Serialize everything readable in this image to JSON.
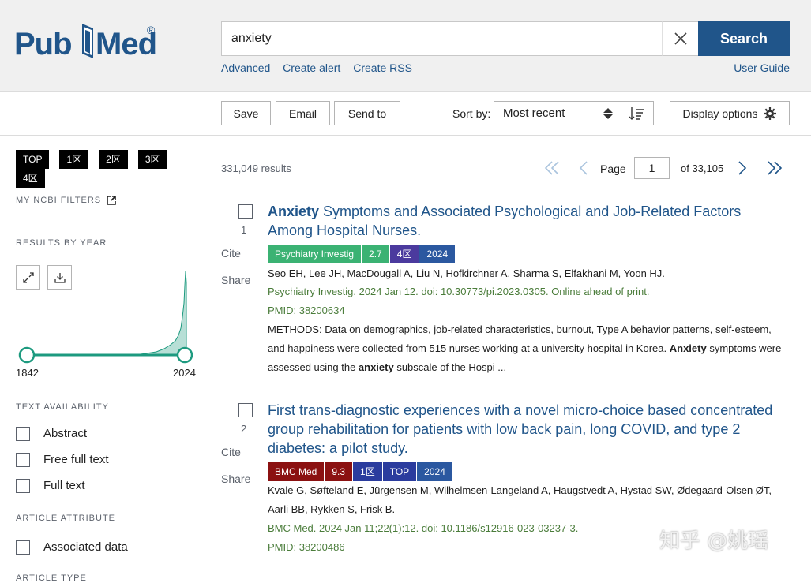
{
  "header": {
    "logo_pub": "Pub",
    "logo_med": "Med",
    "logo_reg": "®",
    "search_value": "anxiety",
    "search_button": "Search",
    "links": [
      "Advanced",
      "Create alert",
      "Create RSS"
    ],
    "user_guide": "User Guide"
  },
  "toolbar": {
    "save": "Save",
    "email": "Email",
    "send_to": "Send to",
    "sort_label": "Sort by:",
    "sort_value": "Most recent",
    "display_options": "Display options"
  },
  "sidebar": {
    "tags": [
      "TOP",
      "1区",
      "2区",
      "3区",
      "4区"
    ],
    "my_ncbi_filters": "MY NCBI FILTERS",
    "results_by_year": "RESULTS BY YEAR",
    "year_start": "1842",
    "year_end": "2024",
    "text_availability": "TEXT AVAILABILITY",
    "text_filters": [
      "Abstract",
      "Free full text",
      "Full text"
    ],
    "article_attribute": "ARTICLE ATTRIBUTE",
    "attribute_filters": [
      "Associated data"
    ],
    "article_type": "ARTICLE TYPE"
  },
  "results": {
    "count": "331,049 results",
    "page_label": "Page",
    "page_value": "1",
    "of_pages": "of 33,105",
    "items": [
      {
        "num": "1",
        "title_bold": "Anxiety",
        "title_rest": " Symptoms and Associated Psychological and Job-Related Factors Among Hospital Nurses.",
        "badges": [
          "Psychiatry Investig",
          "2.7",
          "4区",
          "2024"
        ],
        "authors": "Seo EH, Lee JH, MacDougall A, Liu N, Hofkirchner A, Sharma S, Elfakhani M, Yoon HJ.",
        "journal": "Psychiatry Investig. 2024 Jan 12. doi: 10.30773/pi.2023.0305. Online ahead of print.",
        "pmid": "PMID: 38200634",
        "snippet_1": "METHODS: Data on demographics, job-related characteristics, burnout, Type A behavior patterns, self-esteem, and happiness were collected from 515 nurses working at a university hospital in Korea. ",
        "snippet_b1": "Anxiety",
        "snippet_2": " symptoms were assessed using the ",
        "snippet_b2": "anxiety",
        "snippet_3": " subscale of the Hospi ..."
      },
      {
        "num": "2",
        "title_bold": "",
        "title_rest": "First trans-diagnostic experiences with a novel micro-choice based concentrated group rehabilitation for patients with low back pain, long COVID, and type 2 diabetes: a pilot study.",
        "badges": [
          "BMC Med",
          "9.3",
          "1区",
          "TOP",
          "2024"
        ],
        "authors": "Kvale G, Søfteland E, Jürgensen M, Wilhelmsen-Langeland A, Haugstvedt A, Hystad SW, Ødegaard-Olsen ØT, Aarli BB, Rykken S, Frisk B.",
        "journal": "BMC Med. 2024 Jan 11;22(1):12. doi: 10.1186/s12916-023-03237-3.",
        "pmid": "PMID: 38200486"
      }
    ],
    "cite": "Cite",
    "share": "Share"
  },
  "colors": {
    "brand": "#20558a",
    "journal_green": "#4a7c3a"
  },
  "watermark": "知乎 @姚瑶"
}
